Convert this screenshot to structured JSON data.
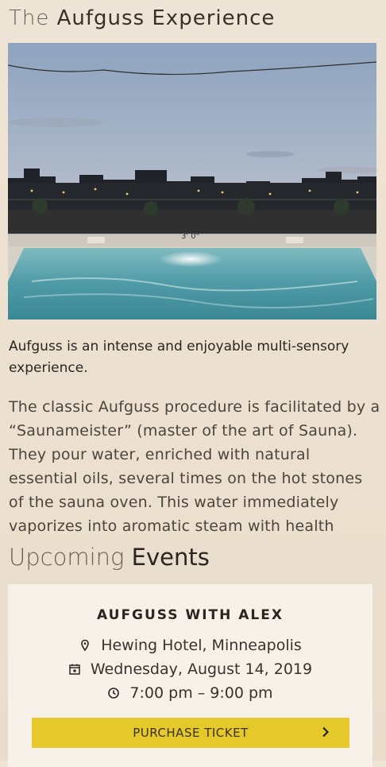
{
  "page": {
    "title_light": "The",
    "title_strong": "Aufguss Experience"
  },
  "intro": {
    "text": "Aufguss is an intense and enjoyable multi-sensory experience."
  },
  "description": {
    "text": "The classic Aufguss procedure is facilitated by a “Saunameister” (master of the art of Sauna). They pour water, enriched with natural essential oils, several times on the hot stones of the sauna oven. This water immediately vaporizes into aromatic steam with health enhancing qualities."
  },
  "events_section": {
    "title_light": "Upcoming",
    "title_strong": "Events"
  },
  "event": {
    "name": "AUFGUSS WITH ALEX",
    "location": "Hewing Hotel, Minneapolis",
    "date": "Wednesday, August 14, 2019",
    "time": "7:00 pm – 9:00 pm",
    "button_label": "PURCHASE TICKET",
    "location_icon": "map-pin-icon",
    "date_icon": "calendar-icon",
    "time_icon": "clock-icon",
    "button_icon": "chevron-right-icon"
  },
  "photo": {
    "pool_marking": "3' 0\""
  },
  "colors": {
    "background": "#efe5d6",
    "card": "#f7f1ea",
    "button": "#e5c92b"
  }
}
